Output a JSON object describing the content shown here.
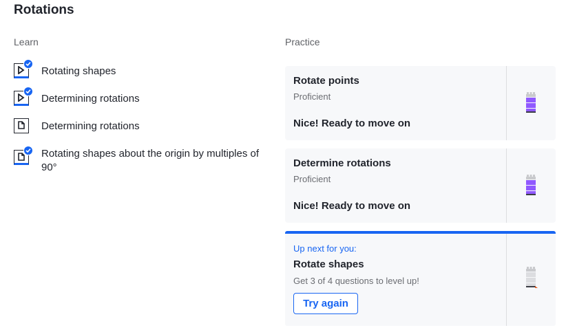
{
  "page": {
    "title": "Rotations"
  },
  "learn": {
    "label": "Learn",
    "items": [
      {
        "label": "Rotating shapes",
        "icon": "video-icon",
        "completed": true
      },
      {
        "label": "Determining rotations",
        "icon": "video-icon",
        "completed": true
      },
      {
        "label": "Determining rotations",
        "icon": "article-icon",
        "completed": false
      },
      {
        "label": "Rotating shapes about the origin by multiples of 90°",
        "icon": "article-icon",
        "completed": true
      }
    ]
  },
  "practice": {
    "label": "Practice",
    "cards": [
      {
        "name": "Rotate points",
        "status": "Proficient",
        "message": "Nice! Ready to move on",
        "mastery_level": "proficient"
      },
      {
        "name": "Determine rotations",
        "status": "Proficient",
        "message": "Nice! Ready to move on",
        "mastery_level": "proficient"
      }
    ],
    "up_next": {
      "header": "Up next for you:",
      "name": "Rotate shapes",
      "hint": "Get 3 of 4 questions to level up!",
      "button_label": "Try again",
      "mastery_level": "attempted"
    }
  },
  "colors": {
    "accent": "#1865f2",
    "proficient": "#9059ff",
    "attempted_marker": "#e35c20"
  }
}
